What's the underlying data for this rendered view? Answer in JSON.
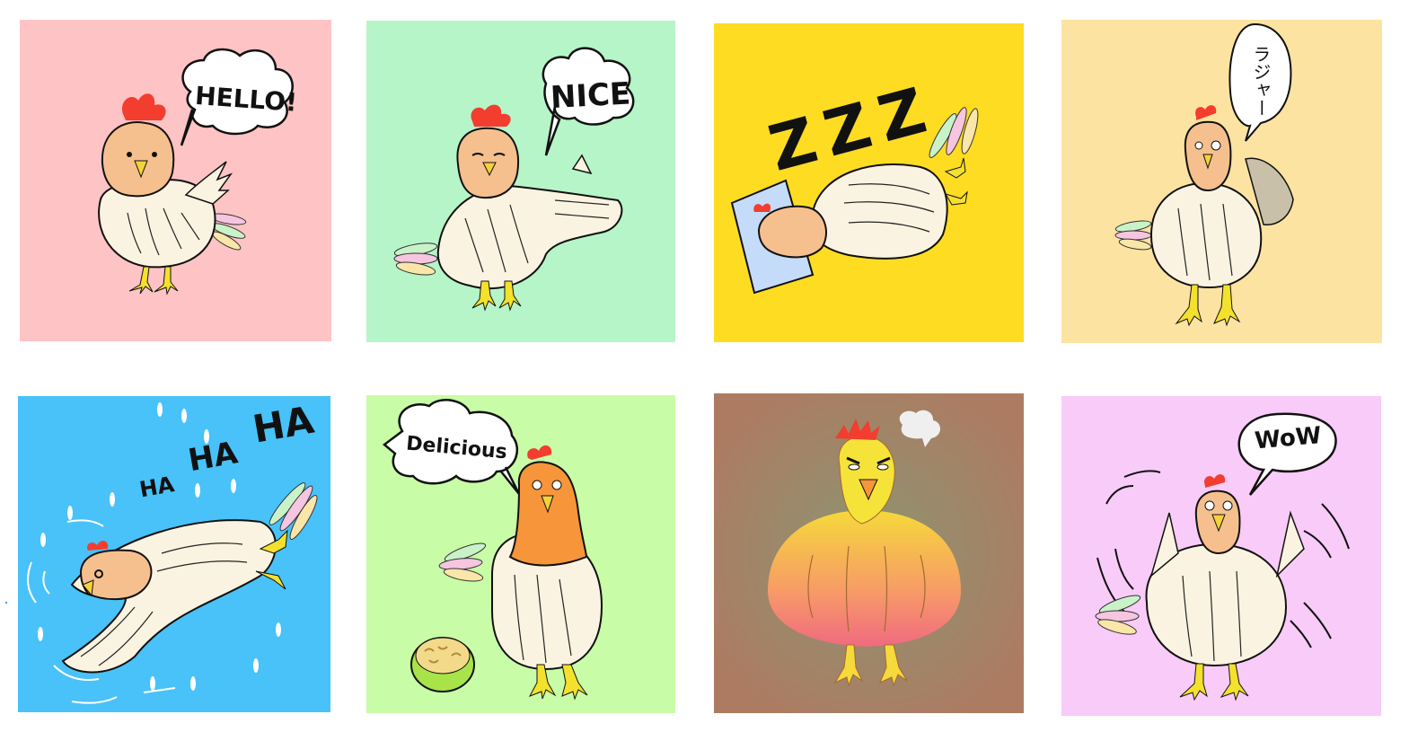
{
  "stickers": [
    {
      "id": "hello",
      "text": "HELLO!",
      "bg": "#fec3c4"
    },
    {
      "id": "nice",
      "text": "NICE",
      "bg": "#b5f5c8"
    },
    {
      "id": "sleep",
      "text": "ZZZ",
      "bg": "#fddc22"
    },
    {
      "id": "roger",
      "text": "ラジャー",
      "bg": "#fde3a2"
    },
    {
      "id": "laugh",
      "text_small": "HA",
      "text_mid": "HA",
      "text_big": "HA",
      "bg": "#48c2f9"
    },
    {
      "id": "delicious",
      "text": "Delicious",
      "bg": "#c8fca7"
    },
    {
      "id": "angry",
      "bg_center": "#8c9571",
      "bg_edge": "#ad7b62"
    },
    {
      "id": "wow",
      "text": "WoW",
      "bg": "#f8cbf8"
    }
  ]
}
